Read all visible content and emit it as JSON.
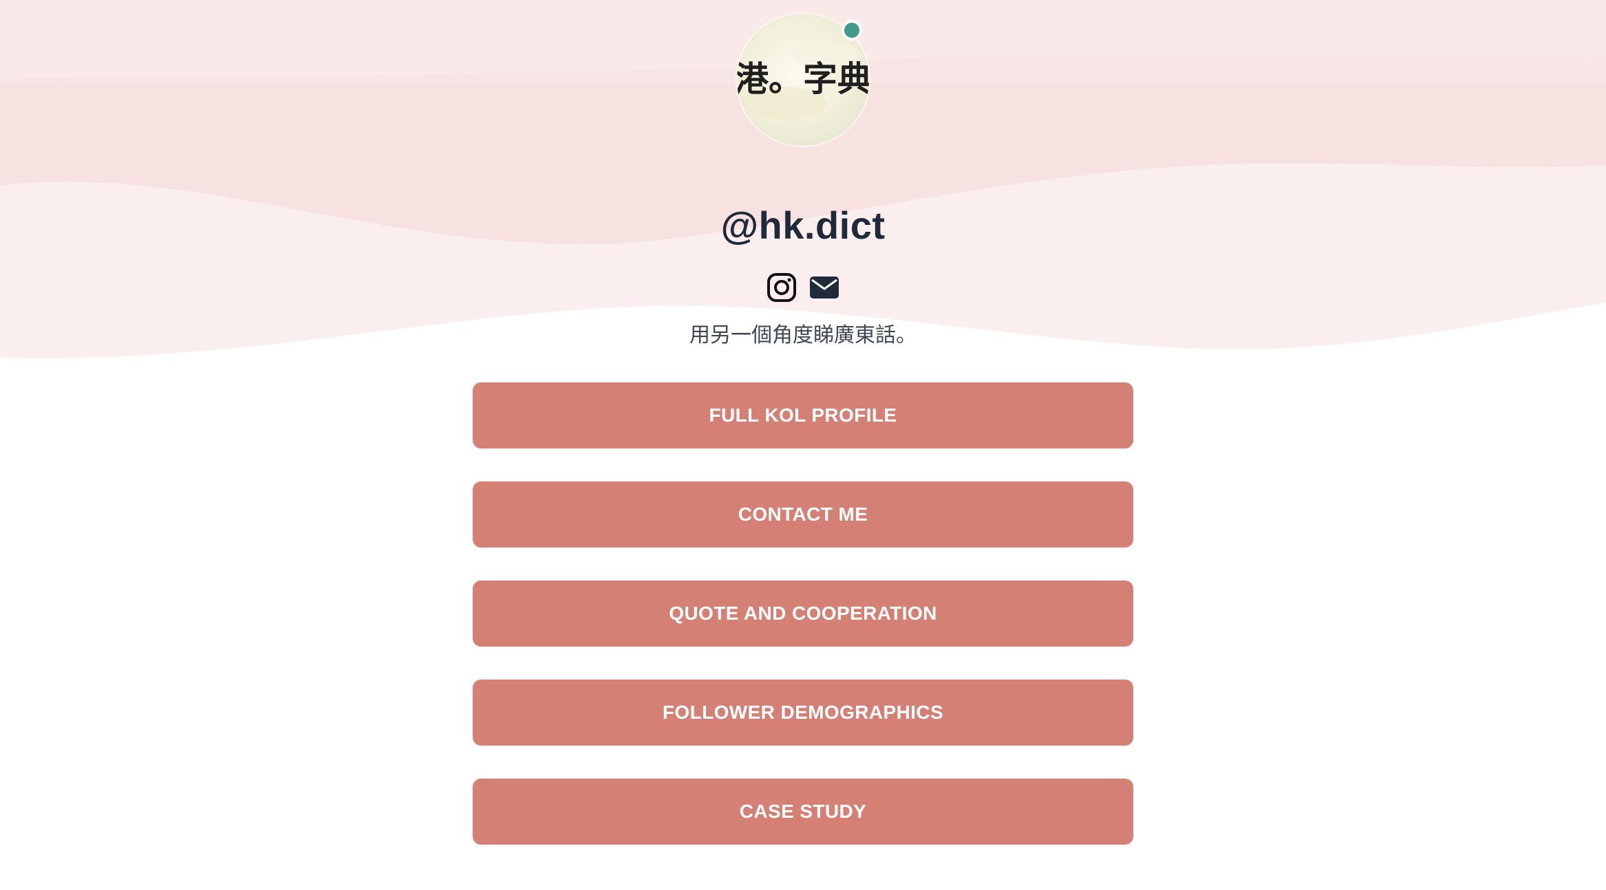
{
  "profile": {
    "logo_text": "港。字典",
    "handle": "@hk.dict",
    "tagline": "用另一個角度睇廣東話。",
    "status": "online",
    "status_color": "#449a88"
  },
  "socials": [
    {
      "icon": "instagram-icon"
    },
    {
      "icon": "email-icon"
    }
  ],
  "links": [
    {
      "label": "FULL KOL PROFILE"
    },
    {
      "label": "CONTACT ME"
    },
    {
      "label": "QUOTE AND COOPERATION"
    },
    {
      "label": "FOLLOWER DEMOGRAPHICS"
    },
    {
      "label": "CASE STUDY"
    }
  ],
  "colors": {
    "button": "#d48075",
    "button_text": "#ffffff",
    "handle_text": "#1f2a3a",
    "background_tint": "#f7e3e2"
  }
}
